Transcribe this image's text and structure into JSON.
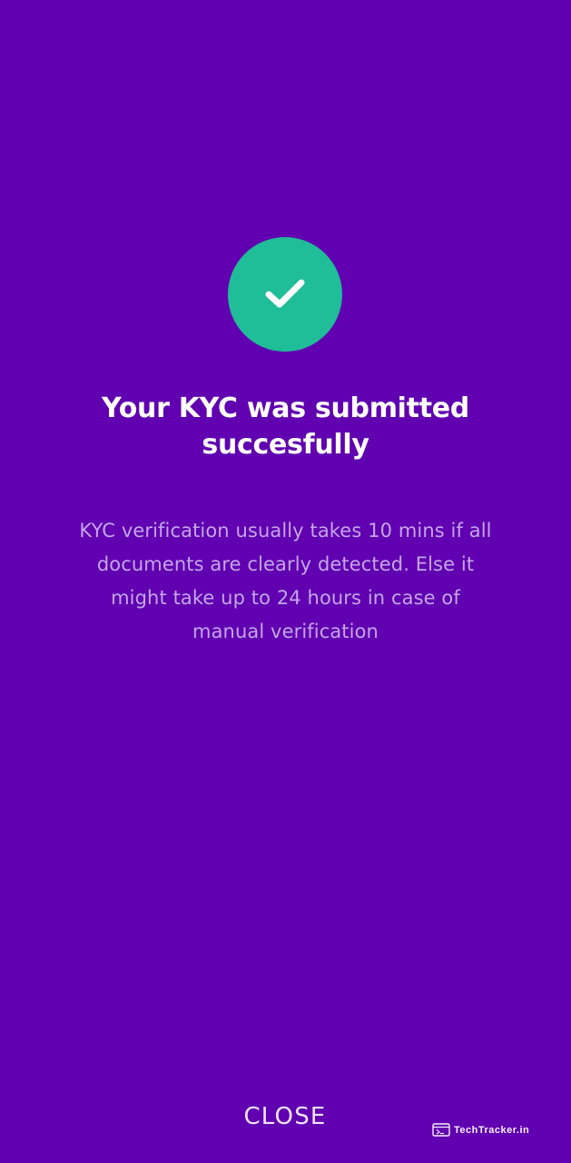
{
  "colors": {
    "background": "#6000b0",
    "success_circle": "#1fbd98",
    "title_text": "#ffffff",
    "description_text": "#c4a6ea",
    "close_text": "#f3e3ff"
  },
  "success": {
    "icon": "checkmark-icon",
    "title": "Your KYC was submitted succesfully",
    "description": "KYC verification usually takes 10 mins if all documents are clearly detected. Else it might take up to 24 hours in case of manual verification"
  },
  "actions": {
    "close_label": "CLOSE"
  },
  "watermark": {
    "icon": "browser-window-icon",
    "text": "TechTracker.in"
  }
}
